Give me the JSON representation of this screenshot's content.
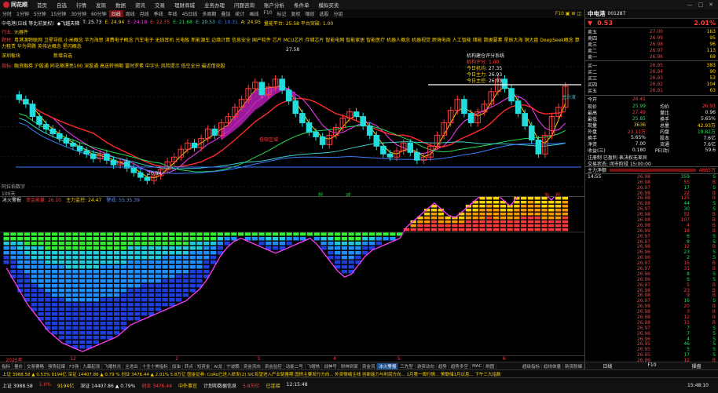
{
  "menubar": {
    "logo": "同花顺",
    "items": [
      "首页",
      "自选",
      "行情",
      "发现",
      "数据",
      "资讯",
      "交易",
      "理财商城",
      "业务办理",
      "问题咨询",
      "账户分析",
      "条件单",
      "模拟买卖"
    ],
    "window_controls": [
      "—",
      "□",
      "✕"
    ]
  },
  "periodbar": {
    "periods": [
      "分时",
      "1分钟",
      "5分钟",
      "15分钟",
      "30分钟",
      "60分钟",
      "日线",
      "周线",
      "月线",
      "季线",
      "年线",
      "45日线",
      "多周期",
      "叠加",
      "统计",
      "画线",
      "F10",
      "标记",
      "复权",
      "缩放",
      "选股",
      "分组"
    ],
    "active_index": 6,
    "tools": "F10 ▣ ⊞ ◫",
    "status_line": "量能平台: 25.58  平台突破: 1.00"
  },
  "main_chart": {
    "title": "中电港(日线 等比前复权)",
    "ma_labels": [
      {
        "text": "◆飞越天梯",
        "color": "#ffffff"
      },
      {
        "text": "T: 25.73",
        "color": "#ffffff"
      },
      {
        "text": "E: 24.94",
        "color": "#ffd400"
      },
      {
        "text": "E: 24.18",
        "color": "#ff3bff"
      },
      {
        "text": "E: 22.75",
        "color": "#ff3b3b"
      },
      {
        "text": "E: 21.68",
        "color": "#22dd55"
      },
      {
        "text": "E: 20.53",
        "color": "#3ccccc"
      },
      {
        "text": "E: 19.31",
        "color": "#3b7bff"
      },
      {
        "text": "A: 24.95",
        "color": "#ffd400"
      }
    ],
    "concept_prefix": "题材:",
    "concepts": "粤港澳物联网 卫星导航 小米概念 华为海思 消费电子概念 汽车电子 无线耳机 光电板 新能源车 边缘计算 信息安全 国产软件 芯片 MCU芯片 存储芯片 智能电网 智能家居 智能医疗 机器人概念 机器视觉 跨境电商 人工智能 储能 数据要素 星辰大海 铜大盘 DeepSeek概念 算力租赁 华为昇腾 英伟达概念 星闪概念",
    "industry_prefix": "行业:",
    "industry": "元器件",
    "line2_prefix": "指标:",
    "line2": "融资融券 沪股通 同花顺漂亮100 深股通 高送转预期 富时罗素 中字头 风险提示 低空全分 最近借壳股",
    "sector_tag": "深圳板块",
    "flag_tag": "新增自选",
    "high_label": "27.58",
    "low_label": "20.84",
    "signal_label": "低吸区域",
    "sys_box": {
      "title": "机构建仓评分系统",
      "rows": [
        {
          "label": "机构评分:",
          "value": "1.00"
        },
        {
          "label": "今日机均:",
          "value": "27.35"
        },
        {
          "label": "今日主力:",
          "value": "26.93"
        },
        {
          "label": "今日主控:",
          "value": "26.93"
        }
      ]
    },
    "wave_tag": "主升浪",
    "bottom_tags": [
      "拐",
      "减"
    ],
    "bottom_tag_right": [
      "加",
      "拐"
    ],
    "y_axis": [
      "26.95",
      "25.20",
      "24.00",
      "23.00",
      "22.00",
      "21.00",
      "20.00"
    ],
    "left_note": "阿拉伯数字",
    "volume_note": "100天",
    "chart_data": {
      "type": "candlestick",
      "ylim": [
        20.5,
        28.2
      ],
      "high": 27.58,
      "low": 20.84,
      "last": 26.95,
      "series_close": [
        26.1,
        25.8,
        25.0,
        24.5,
        24.2,
        23.9,
        23.6,
        23.3,
        23.1,
        22.8,
        22.6,
        22.3,
        22.6,
        22.2,
        21.9,
        22.1,
        21.7,
        21.4,
        21.1,
        20.9,
        21.2,
        21.6,
        22.1,
        22.4,
        22.9,
        23.3,
        23.0,
        23.6,
        24.2,
        23.8,
        24.6,
        25.0,
        25.6,
        26.1,
        26.8,
        27.2,
        26.4,
        26.9,
        27.4,
        26.7,
        26.0,
        25.2,
        24.6,
        24.0,
        23.7,
        23.2,
        23.8,
        24.3,
        24.9,
        25.3,
        25.0,
        24.4,
        23.8,
        23.1,
        22.6,
        22.4,
        22.8,
        23.3,
        22.7,
        22.2,
        22.4,
        23.1,
        23.8,
        24.6,
        25.4,
        26.1,
        25.2,
        24.6,
        25.3,
        25.8,
        26.6,
        27.4,
        26.8,
        26.0,
        25.2,
        24.4,
        23.5,
        22.6,
        23.8,
        25.0,
        25.6,
        26.95
      ]
    }
  },
  "oscillator": {
    "title": "冰火警报",
    "fields": [
      {
        "label": "资金能量: 26.10",
        "color": "#ff3b3b"
      },
      {
        "label": "主力监控: 24.47",
        "color": "#ffd400"
      },
      {
        "label": "警戒: 55.35.39",
        "color": "#3b7bff"
      }
    ],
    "chart_data": {
      "type": "bar",
      "values": [
        -22,
        -30,
        -38,
        -46,
        -52,
        -58,
        -64,
        -68,
        -72,
        -74,
        -76,
        -78,
        -76,
        -74,
        -72,
        -70,
        -68,
        -64,
        -60,
        -58,
        -56,
        -54,
        -52,
        -50,
        -48,
        -46,
        -44,
        -40,
        -36,
        -30,
        -22,
        -14,
        -8,
        -4,
        -2,
        -4,
        -6,
        -8,
        -10,
        -12,
        -10,
        -8,
        -6,
        -4,
        -2,
        -6,
        -12,
        -18,
        -24,
        -28,
        -26,
        -20,
        -14,
        -10,
        -8,
        -6,
        -4,
        -2,
        2,
        6,
        10,
        14,
        18,
        14,
        10,
        8,
        12,
        16,
        20,
        24,
        28,
        24,
        20,
        16,
        22,
        28,
        32,
        28,
        24,
        20,
        26,
        32
      ]
    }
  },
  "date_axis": {
    "labels": [
      {
        "text": "2025年",
        "pos": 0.01
      },
      {
        "text": "12",
        "pos": 0.12
      },
      {
        "text": "2",
        "pos": 0.3
      },
      {
        "text": "3",
        "pos": 0.44
      },
      {
        "text": "4",
        "pos": 0.57
      },
      {
        "text": "5",
        "pos": 0.68
      },
      {
        "text": "6",
        "pos": 0.86
      }
    ]
  },
  "tabbar": {
    "tabs": [
      "指标",
      "量价",
      "交易要略",
      "强势起爆",
      "F3强",
      "九幕起涨",
      "飞曜核光",
      "主进出",
      "十全十美指标",
      "加油",
      "转点",
      "短资金",
      "AI龙",
      "宁波鹏",
      "资金流向",
      "资金监控",
      "动能二号",
      "飞曜核",
      "战神号",
      "财神到家",
      "资金流",
      "冰火警报",
      "三先型",
      "游资动向",
      "趋势",
      "趋势多空",
      "MAC",
      "刷图"
    ],
    "active_index": 21,
    "right_tabs": [
      "超级指标",
      "趋线体量",
      "新资股编"
    ]
  },
  "quote": {
    "name": "中电港",
    "code": "001287",
    "arrow": "▼",
    "change": "0.53",
    "pct": "2.01%",
    "asks": [
      {
        "label": "卖五",
        "price": "27.00",
        "vol": "163"
      },
      {
        "label": "卖四",
        "price": "26.99",
        "vol": "95"
      },
      {
        "label": "卖三",
        "price": "26.98",
        "vol": "96"
      },
      {
        "label": "卖二",
        "price": "26.97",
        "vol": "113"
      },
      {
        "label": "卖一",
        "price": "26.96",
        "vol": "69"
      }
    ],
    "last_price": "26.95",
    "bids": [
      {
        "label": "买一",
        "price": "26.95",
        "vol": "383"
      },
      {
        "label": "买二",
        "price": "26.94",
        "vol": "90"
      },
      {
        "label": "买三",
        "price": "26.93",
        "vol": "53"
      },
      {
        "label": "买四",
        "price": "26.92",
        "vol": "104"
      },
      {
        "label": "买五",
        "price": "26.91",
        "vol": "63"
      }
    ],
    "stats": [
      {
        "l1": "今开",
        "v1": "26.41",
        "c1": "red",
        "l2": "",
        "v2": "",
        "c2": "white"
      },
      {
        "l1": "现价",
        "v1": "25.99",
        "c1": "green",
        "l2": "均价",
        "v2": "26.93",
        "c2": "red"
      },
      {
        "l1": "最高",
        "v1": "27.49",
        "c1": "red",
        "l2": "量比",
        "v2": "0.96",
        "c2": "white"
      },
      {
        "l1": "最低",
        "v1": "25.85",
        "c1": "green",
        "l2": "换手",
        "v2": "5.65%",
        "c2": "white"
      },
      {
        "l1": "现量",
        "v1": "3636",
        "c1": "yellow",
        "l2": "总量",
        "v2": "42.93万",
        "c2": "yellow"
      },
      {
        "l1": "外盘",
        "v1": "23.11万",
        "c1": "red",
        "l2": "内盘",
        "v2": "19.82万",
        "c2": "green"
      },
      {
        "l1": "换手",
        "v1": "5.65%",
        "c1": "white",
        "l2": "股本",
        "v2": "7.6亿",
        "c2": "white"
      },
      {
        "l1": "净资",
        "v1": "7.00",
        "c1": "white",
        "l2": "流通",
        "v2": "7.6亿",
        "c2": "white"
      },
      {
        "l1": "收益(三)",
        "v1": "0.180",
        "c1": "white",
        "l2": "PE(动)",
        "v2": "59.6",
        "c2": "white"
      }
    ],
    "note1": "注册制 已盈利 表决权无差异",
    "note2": "交易状态: 闭市阶段 15:00:00",
    "flow_label": "主力净额",
    "flow_value": "4865万",
    "ticks": [
      [
        "14:55",
        "26.98",
        "359",
        "S"
      ],
      [
        "",
        "26.98",
        "55",
        "B"
      ],
      [
        "",
        "26.97",
        "17",
        "S"
      ],
      [
        "",
        "26.98",
        "22",
        "B"
      ],
      [
        "",
        "26.98",
        "125",
        "B"
      ],
      [
        "",
        "26.98",
        "44",
        "S"
      ],
      [
        "",
        "26.97",
        "30",
        "S"
      ],
      [
        "",
        "26.98",
        "52",
        "B"
      ],
      [
        "",
        "26.98",
        "107",
        "B"
      ],
      [
        "",
        "26.98",
        "4",
        "B"
      ],
      [
        "",
        "26.99",
        "18",
        "B"
      ],
      [
        "",
        "26.97",
        "6",
        "S"
      ],
      [
        "",
        "26.97",
        "8",
        "S"
      ],
      [
        "",
        "26.98",
        "12",
        "B"
      ],
      [
        "",
        "26.96",
        "23",
        "S"
      ],
      [
        "",
        "26.96",
        "2",
        "S"
      ],
      [
        "",
        "26.97",
        "15",
        "B"
      ],
      [
        "",
        "26.97",
        "31",
        "B"
      ],
      [
        "",
        "26.96",
        "8",
        "S"
      ],
      [
        "",
        "26.96",
        "6",
        "S"
      ],
      [
        "",
        "26.97",
        "5",
        "B"
      ],
      [
        "",
        "26.98",
        "23",
        "B"
      ],
      [
        "",
        "26.98",
        "9",
        "B"
      ],
      [
        "",
        "26.97",
        "16",
        "S"
      ],
      [
        "",
        "26.98",
        "20",
        "B"
      ],
      [
        "",
        "26.98",
        "3",
        "B"
      ],
      [
        "",
        "26.98",
        "12",
        "B"
      ],
      [
        "",
        "26.98",
        "11",
        "B"
      ],
      [
        "",
        "26.97",
        "7",
        "S"
      ],
      [
        "",
        "26.96",
        "7",
        "S"
      ],
      [
        "",
        "26.96",
        "4",
        "S"
      ],
      [
        "",
        "26.95",
        "46",
        "S"
      ],
      [
        "",
        "26.95",
        "5",
        "S"
      ],
      [
        "",
        "26.95",
        "17",
        "S"
      ],
      [
        "",
        "26.96",
        "12",
        "B"
      ],
      [
        "15:00",
        "26.95",
        "3636",
        "S"
      ]
    ],
    "bottom_tabs": [
      "日线",
      "F10",
      "操盘"
    ]
  },
  "ticker": "上证 3988.58 ▲ 0.53% 9194亿  深证 14407.86 ▲ 0.79 %  创业 3476.44 ▲ 2.01% 5.8万亿  国金证券: CoRo已进入研发(2)  SIC有望进入产业链量期  国债主要发行方向...  外资情绪主线  创新能力与利润方向...  1月第一周行情...  美联储1月议息...  下午三大指数",
  "status": {
    "items": [
      "上证 3988.58",
      "1.0%",
      "9194亿",
      "深证 14407.86 ▲ 0.79%",
      "创业 3476.44",
      "中外事宜",
      "计划和数据信息",
      "5.8万亿",
      "已连接",
      "12:15:48"
    ],
    "time": "15:48:10"
  }
}
